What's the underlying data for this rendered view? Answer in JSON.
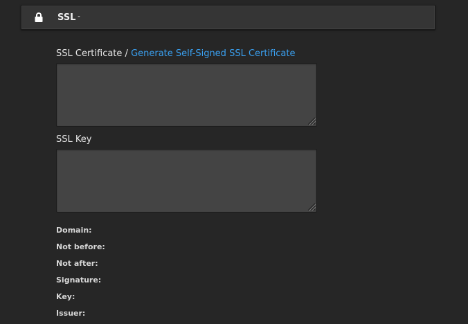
{
  "header": {
    "icon": "lock-icon",
    "title": "SSL"
  },
  "form": {
    "certificate_label": "SSL Certificate / ",
    "generate_link": "Generate Self-Signed SSL Certificate",
    "certificate_value": "",
    "key_label": "SSL Key",
    "key_value": ""
  },
  "info": {
    "domain_label": "Domain:",
    "domain_value": "",
    "not_before_label": "Not before:",
    "not_before_value": "",
    "not_after_label": "Not after:",
    "not_after_value": "",
    "signature_label": "Signature:",
    "signature_value": "",
    "key_label": "Key:",
    "key_value": "",
    "issuer_label": "Issuer:",
    "issuer_value": ""
  },
  "colors": {
    "background": "#262626",
    "header_bg": "#353535",
    "input_bg": "#444444",
    "link": "#3aa0f0"
  }
}
